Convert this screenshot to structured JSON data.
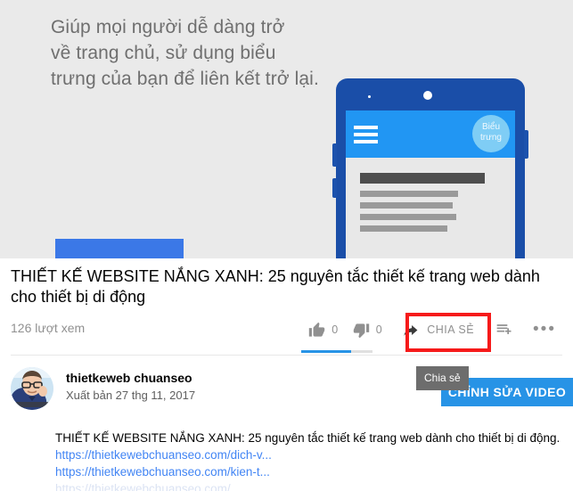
{
  "player": {
    "caption": "Giúp mọi người dễ dàng trở\nvề trang chủ, sử dụng biểu\ntrưng của bạn để liên kết trở lại.",
    "phone_logo_line1": "Biểu",
    "phone_logo_line2": "trưng",
    "background_color": "#eaeaea",
    "cta_color": "#3b78e7",
    "phone_frame_color": "#1a4ea8",
    "phone_topbar_color": "#2196f3"
  },
  "video": {
    "title": "THIẾT KẾ WEBSITE NẮNG XANH: 25 nguyên tắc thiết kế trang web dành cho thiết bị di động",
    "views": "126 lượt xem",
    "like_count": "0",
    "dislike_count": "0",
    "like_ratio_percent": 70
  },
  "actions": {
    "like_label": "like-icon",
    "dislike_label": "dislike-icon",
    "share_label": "CHIA SẺ",
    "save_label": "save-to-playlist-icon",
    "more_label": "•••"
  },
  "tooltip": {
    "text": "Chia sẻ"
  },
  "channel": {
    "name": "thietkeweb chuanseo",
    "published": "Xuất bản 27 thg 11, 2017",
    "edit_button": "CHỈNH SỬA VIDEO"
  },
  "description": {
    "line1": "THIẾT KẾ WEBSITE NẮNG XANH: 25 nguyên tắc thiết kế trang web dành cho thiết bị di động.",
    "link1": "https://thietkewebchuanseo.com/dich-v...",
    "link2": "https://thietkewebchuanseo.com/kien-t...",
    "link3": "https://thietkewebchuanseo.com/..."
  },
  "colors": {
    "accent": "#2793e6",
    "link": "#4285f4",
    "annotation": "#f61a1a",
    "muted_text": "#909090"
  }
}
